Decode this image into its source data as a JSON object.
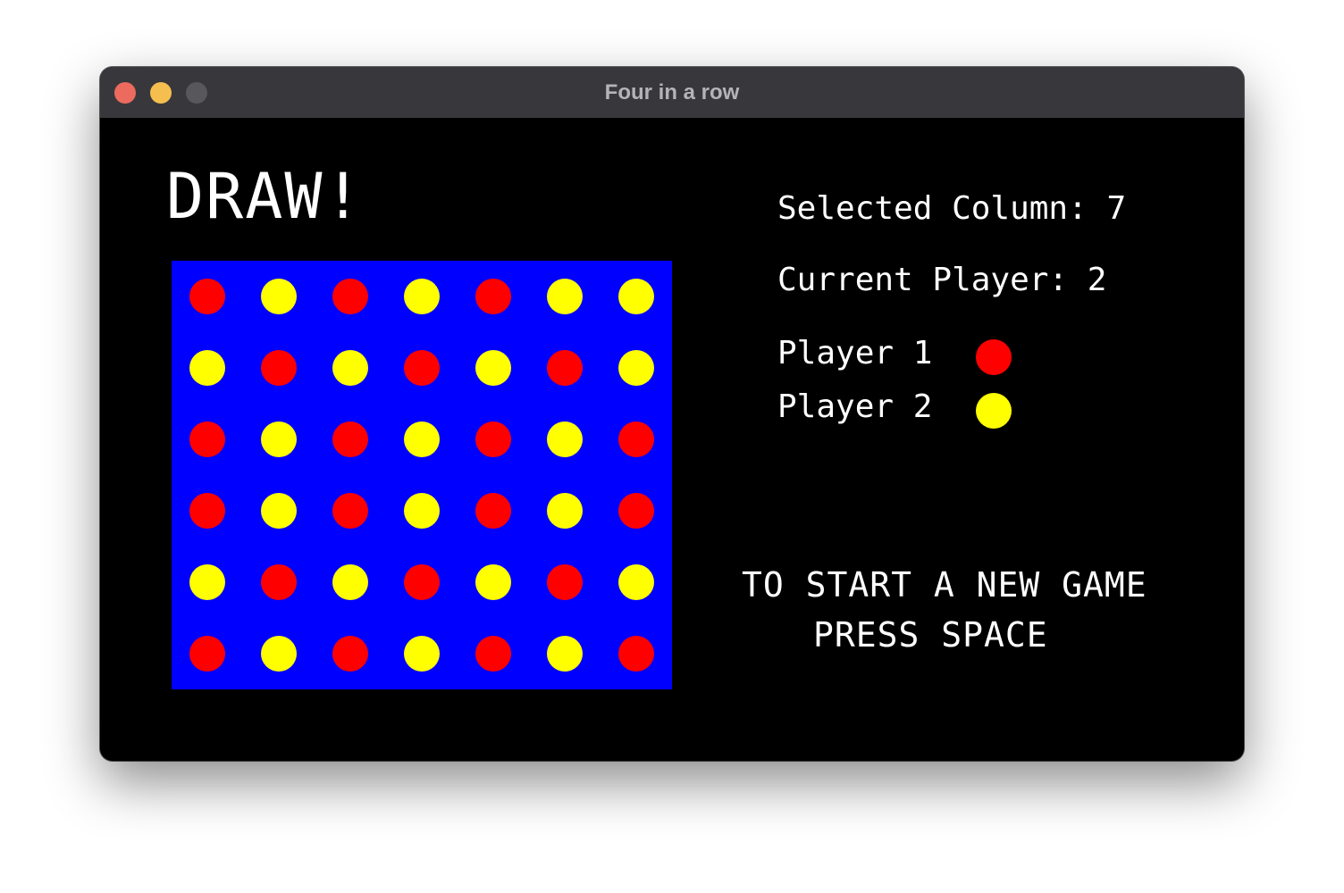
{
  "window": {
    "title": "Four in a row"
  },
  "game": {
    "result_text": "DRAW!",
    "selected_column_text": "Selected Column: 7",
    "current_player_text": "Current Player: 2",
    "legend": [
      {
        "label": "Player 1",
        "color": "#ff0000"
      },
      {
        "label": "Player 2",
        "color": "#ffff00"
      }
    ],
    "restart_line1": "TO START A NEW GAME",
    "restart_line2": "PRESS SPACE"
  },
  "colors": {
    "board": "#0000ff",
    "player1": "#ff0000",
    "player2": "#ffff00",
    "background": "#000000",
    "text": "#ffffff"
  },
  "board": {
    "rows": 6,
    "columns": 7,
    "cells": [
      [
        1,
        2,
        1,
        2,
        1,
        2,
        2
      ],
      [
        2,
        1,
        2,
        1,
        2,
        1,
        2
      ],
      [
        1,
        2,
        1,
        2,
        1,
        2,
        1
      ],
      [
        1,
        2,
        1,
        2,
        1,
        2,
        1
      ],
      [
        2,
        1,
        2,
        1,
        2,
        1,
        2
      ],
      [
        1,
        2,
        1,
        2,
        1,
        2,
        1
      ]
    ]
  }
}
